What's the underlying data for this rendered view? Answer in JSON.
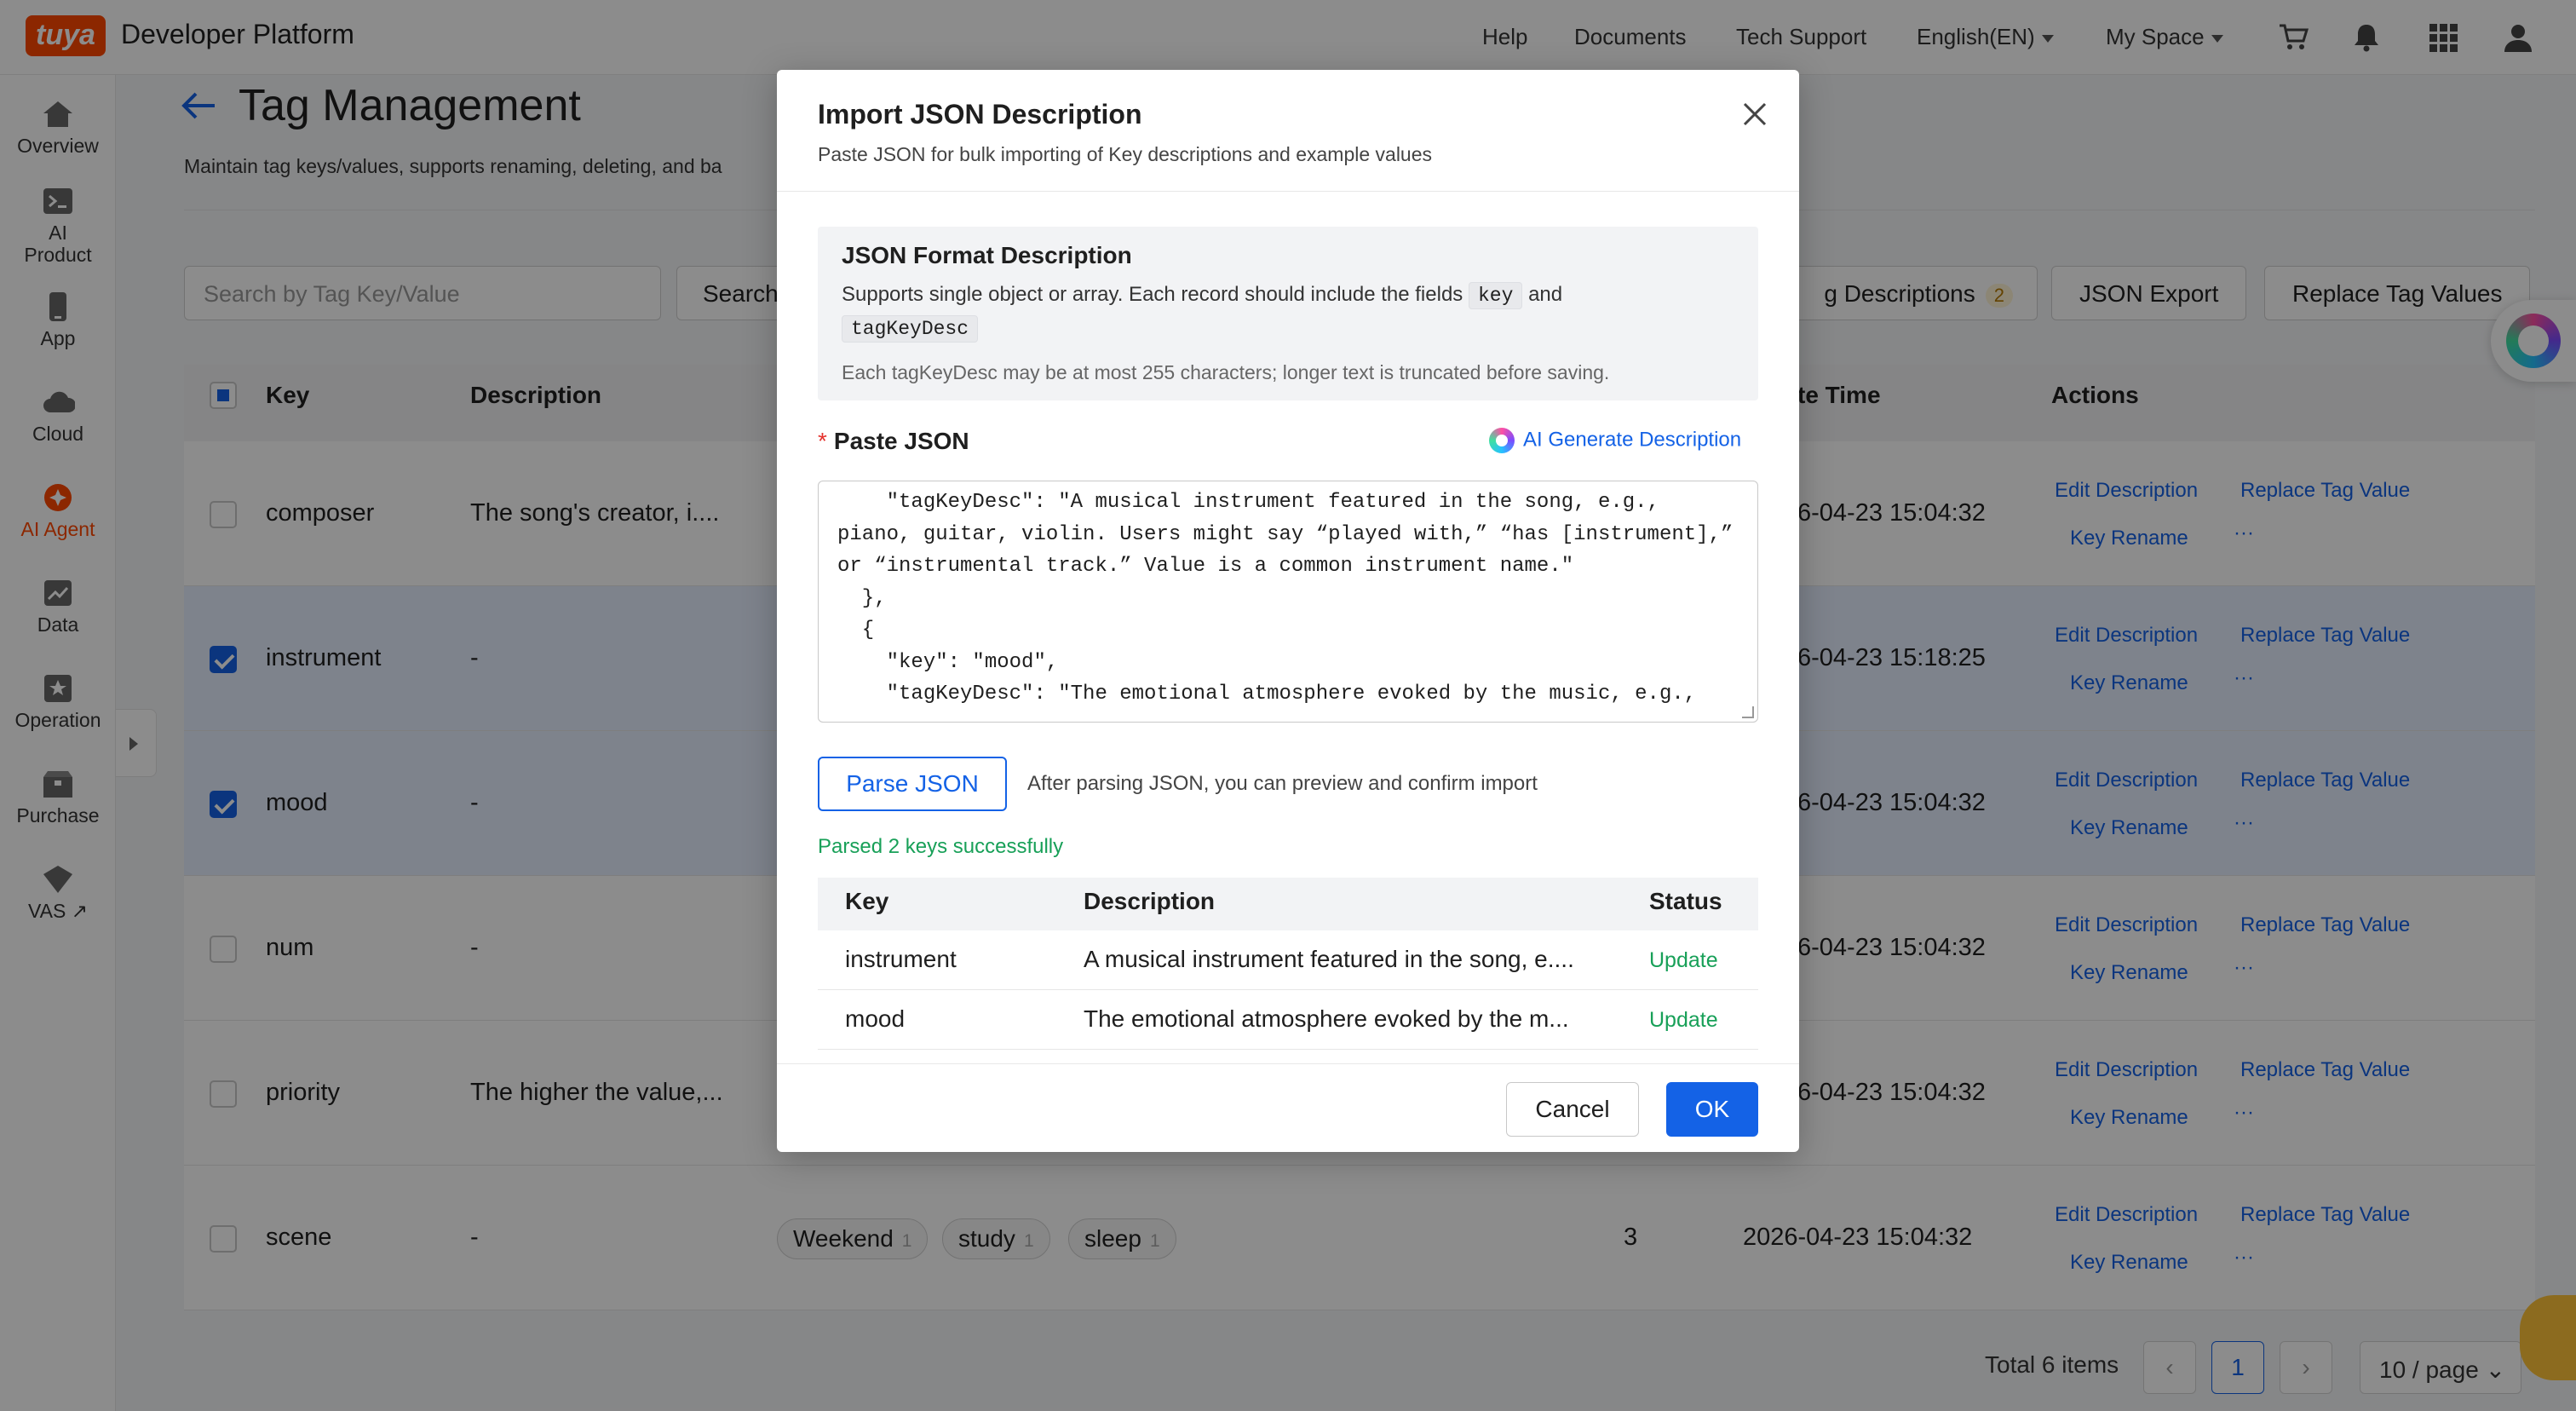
{
  "header": {
    "logo_text": "tuya",
    "title": "Developer Platform",
    "nav": [
      "Help",
      "Documents",
      "Tech Support"
    ],
    "language": "English(EN)",
    "space": "My Space",
    "icons": [
      "cart-icon",
      "bell-icon",
      "apps-grid-icon",
      "user-icon"
    ]
  },
  "sidebar": {
    "items": [
      {
        "label": "Overview",
        "icon": "home-icon"
      },
      {
        "label": "AI Product",
        "icon": "terminal-icon"
      },
      {
        "label": "App",
        "icon": "phone-icon"
      },
      {
        "label": "Cloud",
        "icon": "cloud-icon"
      },
      {
        "label": "AI Agent",
        "icon": "agent-icon",
        "active": true
      },
      {
        "label": "Data",
        "icon": "chart-icon"
      },
      {
        "label": "Operation",
        "icon": "operation-icon"
      },
      {
        "label": "Purchase",
        "icon": "purchase-icon"
      },
      {
        "label": "VAS",
        "icon": "vas-icon"
      }
    ]
  },
  "page": {
    "title": "Tag Management",
    "description": "Maintain tag keys/values, supports renaming, deleting, and ba",
    "search_placeholder": "Search by Tag Key/Value",
    "search_button": "Search",
    "import_descriptions_label": "g Descriptions",
    "import_badge": "2",
    "json_export": "JSON Export",
    "replace_tag_values": "Replace Tag Values"
  },
  "table": {
    "headers": {
      "key": "Key",
      "description": "Description",
      "time": "te Time",
      "actions": "Actions"
    },
    "action_labels": {
      "edit": "Edit Description",
      "replace": "Replace Tag Value",
      "rename": "Key Rename",
      "more": "···"
    },
    "rows": [
      {
        "key": "composer",
        "description": "The song's creator, i....",
        "time": "6-04-23 15:04:32",
        "selected": false
      },
      {
        "key": "instrument",
        "description": "-",
        "time": "6-04-23 15:18:25",
        "selected": true
      },
      {
        "key": "mood",
        "description": "-",
        "time": "6-04-23 15:04:32",
        "selected": true
      },
      {
        "key": "num",
        "description": "-",
        "time": "6-04-23 15:04:32",
        "selected": false
      },
      {
        "key": "priority",
        "description": "The higher the value,...",
        "time": "6-04-23 15:04:32",
        "selected": false
      },
      {
        "key": "scene",
        "description": "-",
        "time": "2026-04-23 15:04:32",
        "selected": false,
        "count": "3",
        "tags": [
          {
            "label": "Weekend",
            "count": "1"
          },
          {
            "label": "study",
            "count": "1"
          },
          {
            "label": "sleep",
            "count": "1"
          }
        ]
      }
    ]
  },
  "pagination": {
    "total": "Total 6 items",
    "current": "1",
    "page_size": "10 / page"
  },
  "modal": {
    "title": "Import JSON Description",
    "subtitle": "Paste JSON for bulk importing of Key descriptions and example values",
    "format": {
      "title": "JSON Format Description",
      "text_prefix": "Supports single object or array. Each record should include the fields",
      "field_key": "key",
      "text_and": "and",
      "field_desc": "tagKeyDesc",
      "note": "Each tagKeyDesc may be at most 255 characters; longer text is truncated before saving."
    },
    "paste_label": "Paste JSON",
    "required_mark": "*",
    "ai_generate": "AI Generate Description",
    "json_text": "    \"tagKeyDesc\": \"A musical instrument featured in the song, e.g.,\npiano, guitar, violin. Users might say “played with,” “has [instrument],”\nor “instrumental track.” Value is a common instrument name.\"\n  },\n  {\n    \"key\": \"mood\",\n    \"tagKeyDesc\": \"The emotional atmosphere evoked by the music, e.g.,",
    "parse_button": "Parse JSON",
    "parse_hint": "After parsing JSON, you can preview and confirm import",
    "parsed_message": "Parsed 2 keys successfully",
    "preview": {
      "headers": {
        "key": "Key",
        "description": "Description",
        "status": "Status"
      },
      "rows": [
        {
          "key": "instrument",
          "description": "A musical instrument featured in the song, e....",
          "status": "Update"
        },
        {
          "key": "mood",
          "description": "The emotional atmosphere evoked by the m...",
          "status": "Update"
        }
      ]
    },
    "cancel": "Cancel",
    "ok": "OK"
  },
  "colors": {
    "brand": "#ff4800",
    "primary": "#1462e6",
    "success": "#18a058",
    "selected_row": "#e6efff"
  }
}
